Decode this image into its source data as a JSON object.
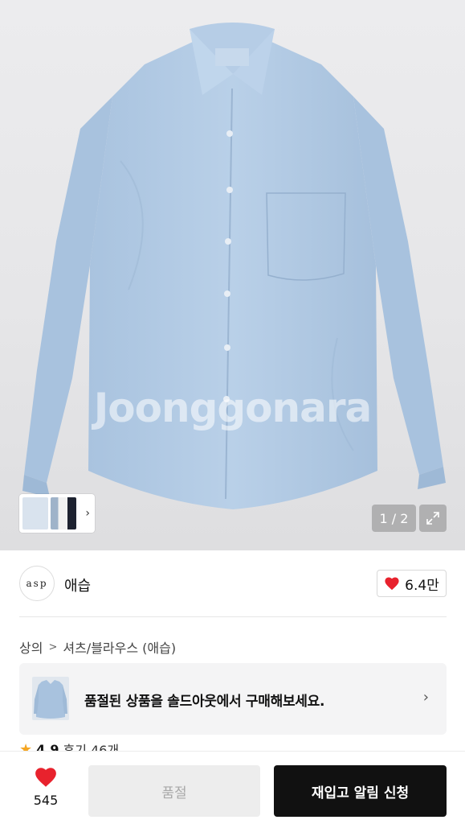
{
  "gallery": {
    "watermark": "Joonggonara",
    "counter": "1 / 2",
    "expand_icon": "expand-icon",
    "thumbnail_next_icon": "chevron-right-icon"
  },
  "seller": {
    "avatar_text": "asp",
    "name": "애습",
    "like_count": "6.4만",
    "like_color": "#e8222d"
  },
  "breadcrumb": [
    "상의",
    "셔츠/블라우스 (애습)"
  ],
  "banner": {
    "text": "품절된 상품을 솔드아웃에서 구매해보세요."
  },
  "rating": {
    "score": "4.9",
    "reviews": "후기 46개"
  },
  "bottom_bar": {
    "wish_count": "545",
    "soldout_label": "품절",
    "restock_label": "재입고 알림 신청"
  }
}
